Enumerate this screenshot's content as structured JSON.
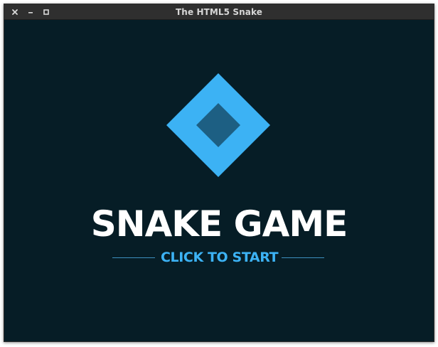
{
  "window": {
    "title": "The HTML5 Snake",
    "controls": {
      "close": "close-icon",
      "minimize": "minimize-icon",
      "maximize": "maximize-icon"
    }
  },
  "game": {
    "title": "SNAKE GAME",
    "start_label": "CLICK TO START",
    "logo_icon": "diamond-logo-icon"
  },
  "colors": {
    "background": "#061d26",
    "titlebar": "#2f2f2f",
    "accent": "#3cb2f4",
    "logo_inner": "#1d5f83",
    "title_text": "#ffffff"
  }
}
